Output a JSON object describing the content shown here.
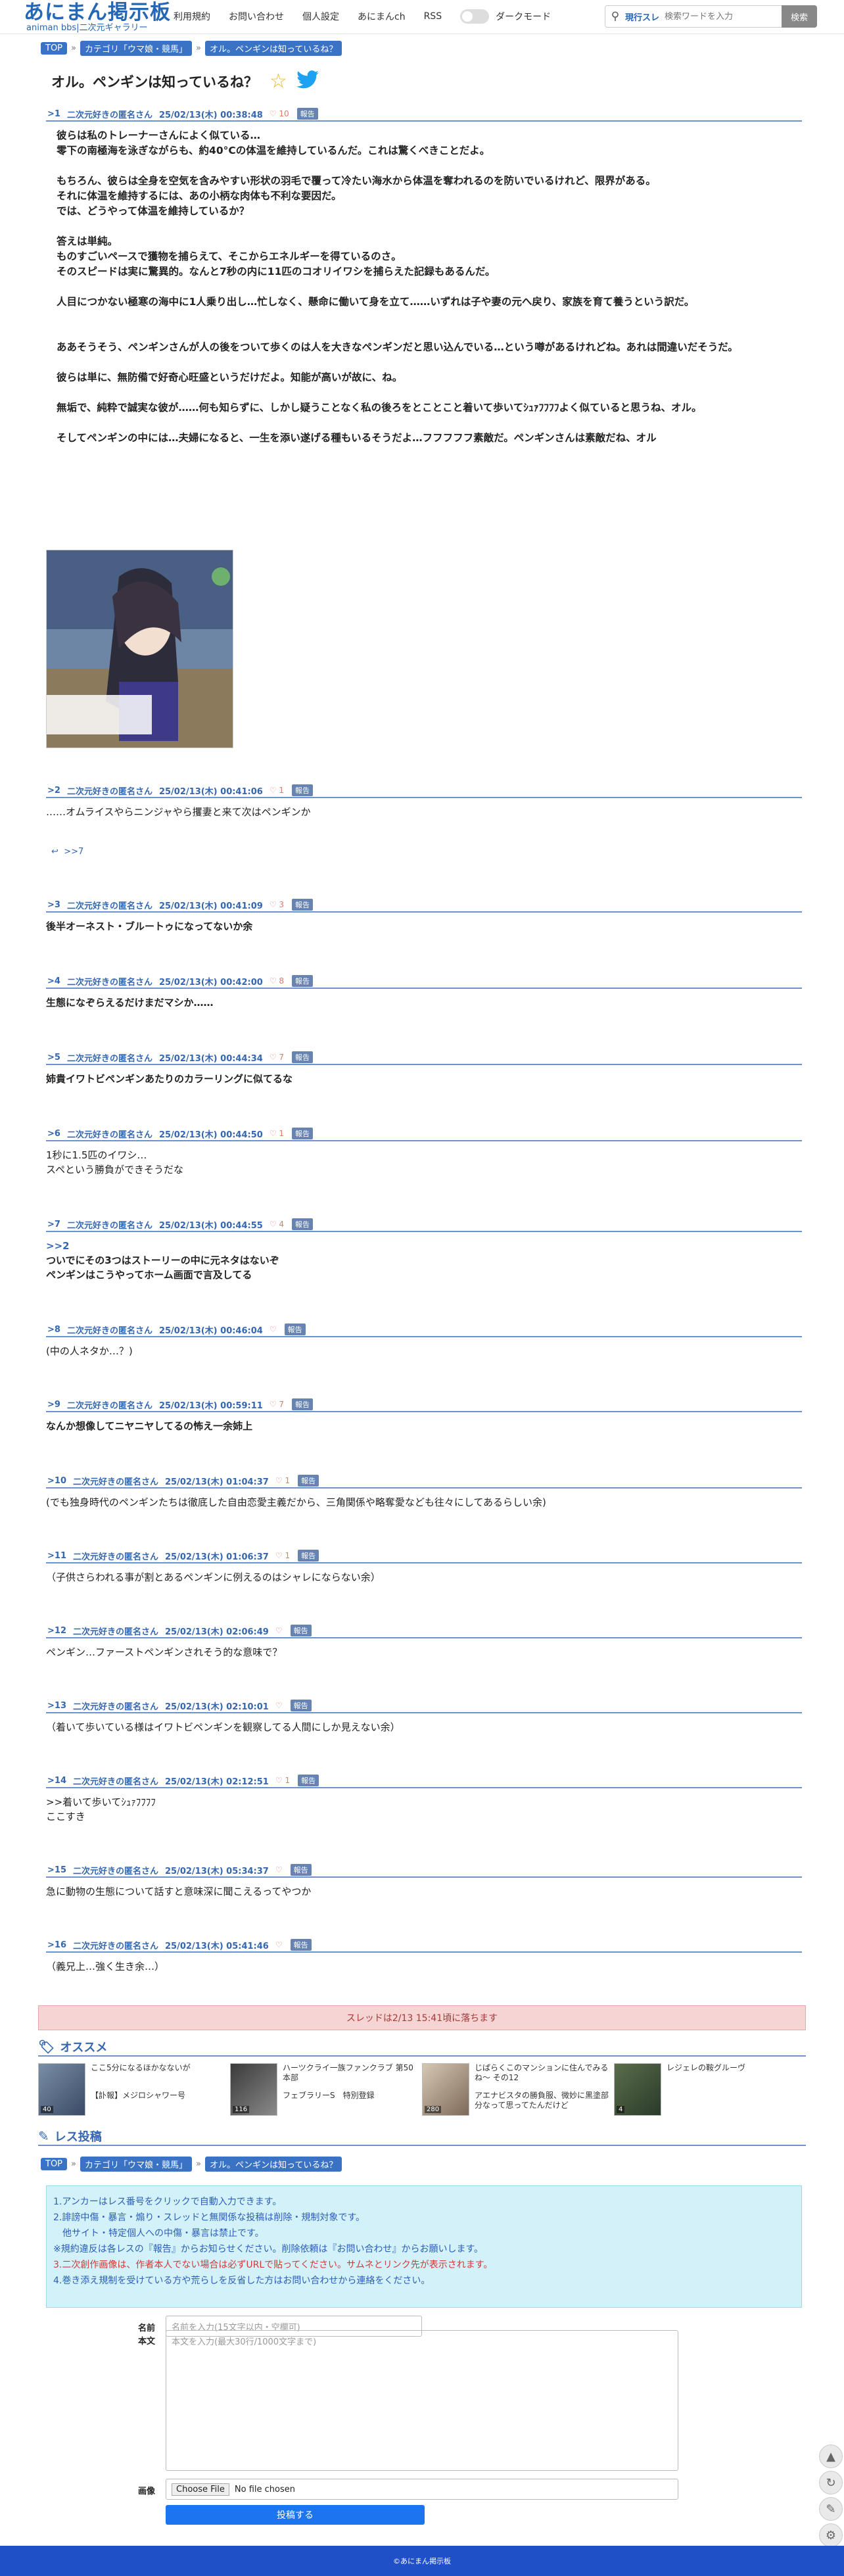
{
  "header": {
    "logo_main": "あにまん掲示板",
    "logo_sub": "animan bbs|二次元ギャラリー",
    "nav": [
      "利用規約",
      "お問い合わせ",
      "個人設定",
      "あにまんch",
      "RSS"
    ],
    "dark_mode": "ダークモード",
    "search": {
      "mode": "現行スレ",
      "placeholder": "検索ワードを入力",
      "button": "検索"
    }
  },
  "breadcrumb": {
    "top": "TOP",
    "cat": "カテゴリ「ウマ娘・競馬」",
    "thread": "オル。ペンギンは知っているね？"
  },
  "title": "オル。ペンギンは知っているね？",
  "posts": [
    {
      "num": ">1",
      "name": "二次元好きの匿名さん",
      "date": "25/02/13(木) 00:38:48",
      "likes": "10",
      "report": "報告",
      "body": "彼らは私のトレーナーさんによく似ている…\n零下の南極海を泳ぎながらも、約40°Cの体温を維持しているんだ。これは驚くべきことだよ。\n\nもちろん、彼らは全身を空気を含みやすい形状の羽毛で覆って冷たい海水から体温を奪われるのを防いでいるけれど、限界がある。\nそれに体温を維持するには、あの小柄な肉体も不利な要因だ。\nでは、どうやって体温を維持しているか？\n\n答えは単純。\nものすごいペースで獲物を捕らえて、そこからエネルギーを得ているのさ。\nそのスピードは実に驚異的。なんと7秒の内に11匹のコオリイワシを捕らえた記録もあるんだ。\n\n人目につかない極寒の海中に1人乗り出し…忙しなく、懸命に働いて身を立て……いずれは子や妻の元へ戻り、家族を育て養うという訳だ。\n\n\nああそうそう、ペンギンさんが人の後をついて歩くのは人を大きなペンギンだと思い込んでいる…という噂があるけれどね。あれは間違いだそうだ。\n\n彼らは単に、無防備で好奇心旺盛というだけだよ。知能が高いが故に、ね。\n\n無垢で、純粋で誠実な彼が……何も知らずに、しかし疑うことなく私の後ろをとことこと着いて歩いてｼｭｧﾌﾌﾌﾌよく似ていると思うね、オル。\n\nそしてペンギンの中には…夫婦になると、一生を添い遂げる種もいるそうだよ…フフフフフ素敵だ。ペンギンさんは素敵だね、オル"
    },
    {
      "num": ">2",
      "name": "二次元好きの匿名さん",
      "date": "25/02/13(木) 00:41:06",
      "likes": "1",
      "report": "報告",
      "body": "……オムライスやらニンジャやら攫妻と来て次はペンギンか",
      "reply": ">>7"
    },
    {
      "num": ">3",
      "name": "二次元好きの匿名さん",
      "date": "25/02/13(木) 00:41:09",
      "likes": "3",
      "report": "報告",
      "body": "後半オーネスト・ブルートゥになってないか余"
    },
    {
      "num": ">4",
      "name": "二次元好きの匿名さん",
      "date": "25/02/13(木) 00:42:00",
      "likes": "8",
      "report": "報告",
      "body": "生態になぞらえるだけまだマシか……"
    },
    {
      "num": ">5",
      "name": "二次元好きの匿名さん",
      "date": "25/02/13(木) 00:44:34",
      "likes": "7",
      "report": "報告",
      "body": "姉貴イワトビペンギンあたりのカラーリングに似てるな"
    },
    {
      "num": ">6",
      "name": "二次元好きの匿名さん",
      "date": "25/02/13(木) 00:44:50",
      "likes": "1",
      "report": "報告",
      "body": "1秒に1.5匹のイワシ…\nスペという勝負ができそうだな"
    },
    {
      "num": ">7",
      "name": "二次元好きの匿名さん",
      "date": "25/02/13(木) 00:44:55",
      "likes": "4",
      "report": "報告",
      "anchor": ">>2",
      "body": "ついでにその3つはストーリーの中に元ネタはないぞ\nペンギンはこうやってホーム画面で言及してる"
    },
    {
      "num": ">8",
      "name": "二次元好きの匿名さん",
      "date": "25/02/13(木) 00:46:04",
      "likes": "",
      "report": "報告",
      "body": "(中の人ネタか…？)"
    },
    {
      "num": ">9",
      "name": "二次元好きの匿名さん",
      "date": "25/02/13(木) 00:59:11",
      "likes": "7",
      "report": "報告",
      "body": "なんか想像してニヤニヤしてるの怖え一余姉上"
    },
    {
      "num": ">10",
      "name": "二次元好きの匿名さん",
      "date": "25/02/13(木) 01:04:37",
      "likes": "1",
      "report": "報告",
      "body": "(でも独身時代のペンギンたちは徹底した自由恋愛主義だから、三角関係や略奪愛なども往々にしてあるらしい余)"
    },
    {
      "num": ">11",
      "name": "二次元好きの匿名さん",
      "date": "25/02/13(木) 01:06:37",
      "likes": "1",
      "report": "報告",
      "body": "（子供さらわれる事が割とあるペンギンに例えるのはシャレにならない余）"
    },
    {
      "num": ">12",
      "name": "二次元好きの匿名さん",
      "date": "25/02/13(木) 02:06:49",
      "likes": "",
      "report": "報告",
      "body": "ペンギン…ファーストペンギンされそう的な意味で？"
    },
    {
      "num": ">13",
      "name": "二次元好きの匿名さん",
      "date": "25/02/13(木) 02:10:01",
      "likes": "",
      "report": "報告",
      "body": "（着いて歩いている様はイワトビペンギンを観察してる人間にしか見えない余）"
    },
    {
      "num": ">14",
      "name": "二次元好きの匿名さん",
      "date": "25/02/13(木) 02:12:51",
      "likes": "1",
      "report": "報告",
      "body": ">>着いて歩いてｼｭｧﾌﾌﾌﾌ\nここすき"
    },
    {
      "num": ">15",
      "name": "二次元好きの匿名さん",
      "date": "25/02/13(木) 05:34:37",
      "likes": "",
      "report": "報告",
      "body": "急に動物の生態について話すと意味深に聞こえるってやつか"
    },
    {
      "num": ">16",
      "name": "二次元好きの匿名さん",
      "date": "25/02/13(木) 05:41:46",
      "likes": "",
      "report": "報告",
      "body": "（義兄上…強く生き余…）"
    }
  ],
  "image_caption": "性格を身体に例えると…なんて話が\n聞できた流行りましてね。\n君方ならペンギン、でしょうか？",
  "closed": "スレッドは2/13 15:41頃に落ちます",
  "recommend": {
    "title": "オススメ",
    "items": [
      {
        "text": "ここ5分になるほかなないが",
        "text2": "【訃報】メジロシャワー号",
        "count": "40"
      },
      {
        "text": "ハーツクライ一族ファンクラブ 第50本部",
        "text2": "フェブラリーS　特別登録",
        "count": "116"
      },
      {
        "text": "じぱらくこのマンションに住んでみるね～ その12",
        "text2": "アエナビスタの勝負服、微妙に黒塗部分なって思ってたんだけど",
        "count": "280"
      },
      {
        "text": "レジェレの鞍グルーヴ",
        "text2": "",
        "count": "4"
      }
    ]
  },
  "post_section": {
    "title": "レス投稿",
    "notice": [
      "1.アンカーはレス番号をクリックで自動入力できます。",
      "2.誹謗中傷・暴言・煽り・スレッドと無関係な投稿は削除・規制対象です。",
      "　他サイト・特定個人への中傷・暴言は禁止です。",
      "※規約違反は各レスの『報告』からお知らせください。削除依頼は『お問い合わせ』からお願いします。",
      "3.二次創作画像は、作者本人でない場合は必ずURLで貼ってください。サムネとリンク先が表示されます。",
      "4.巻き添え規制を受けている方や荒らしを反省した方はお問い合わせから連絡をください。"
    ],
    "name_label": "名前",
    "name_placeholder": "名前を入力(15文字以内・空欄可)",
    "body_label": "本文",
    "body_placeholder": "本文を入力(最大30行/1000文字まで)",
    "image_label": "画像",
    "file_button": "Choose File",
    "file_status": "No file chosen",
    "submit": "投稿する"
  },
  "footer": "©あにまん掲示板"
}
